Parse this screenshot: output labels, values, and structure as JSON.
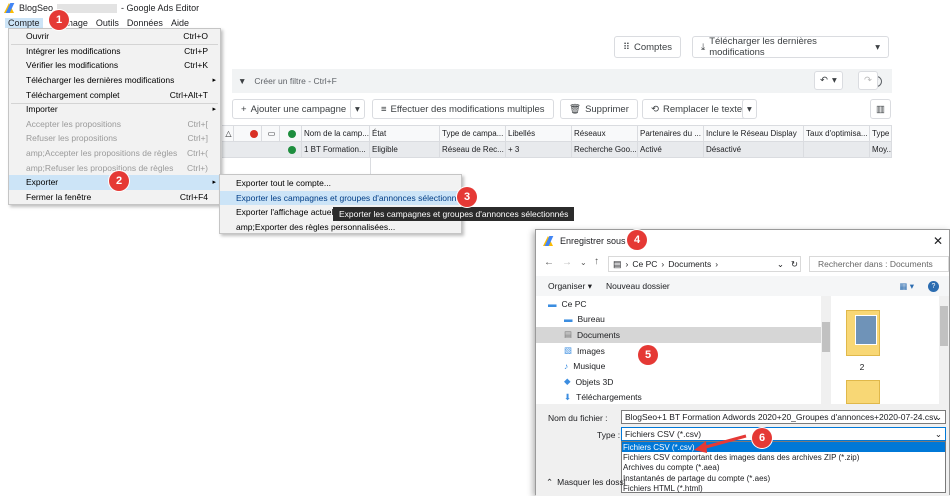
{
  "titlebar": {
    "app_name": "BlogSeo",
    "title_suffix": "- Google Ads Editor"
  },
  "menubar": {
    "items": [
      "Compte",
      "Affichage",
      "Outils",
      "Données",
      "Aide"
    ]
  },
  "toolbar": {
    "accounts_label": "Comptes",
    "download_label": "Télécharger les dernières modifications"
  },
  "filter": {
    "placeholder": "Créer un filtre - Ctrl+F"
  },
  "actions": {
    "add_campaign": "Ajouter une campagne",
    "multiple_changes": "Effectuer des modifications multiples",
    "delete": "Supprimer",
    "replace_text": "Remplacer le texte"
  },
  "grid": {
    "headers": [
      "Nom de la camp...",
      "État",
      "Type de campa...",
      "Libellés",
      "Réseaux",
      "Partenaires du ...",
      "Inclure le Réseau Display",
      "Taux d'optimisa...",
      "Type"
    ],
    "row": [
      "1 BT Formation...",
      "Eligible",
      "Réseau de Rec...",
      "+ 3",
      "Recherche Goo...",
      "Activé",
      "Désactivé",
      "",
      "Moy..."
    ]
  },
  "compte_menu": {
    "items": [
      {
        "label": "Ouvrir",
        "shortcut": "Ctrl+O"
      },
      {
        "label": "Intégrer les modifications",
        "shortcut": "Ctrl+P"
      },
      {
        "label": "Vérifier les modifications",
        "shortcut": "Ctrl+K"
      },
      {
        "label": "Télécharger les dernières modifications",
        "shortcut": ""
      },
      {
        "label": "Téléchargement complet",
        "shortcut": "Ctrl+Alt+T"
      },
      {
        "label": "Importer",
        "shortcut": ""
      },
      {
        "label": "Accepter les propositions",
        "shortcut": "Ctrl+["
      },
      {
        "label": "Refuser les propositions",
        "shortcut": "Ctrl+]"
      },
      {
        "label": "amp;Accepter les propositions de règles",
        "shortcut": "Ctrl+("
      },
      {
        "label": "amp;Refuser les propositions de règles",
        "shortcut": "Ctrl+)"
      },
      {
        "label": "Exporter",
        "shortcut": ""
      },
      {
        "label": "Fermer la fenêtre",
        "shortcut": "Ctrl+F4"
      }
    ]
  },
  "export_submenu": {
    "items": [
      "Exporter tout le compte...",
      "Exporter les campagnes et groupes d'annonces sélectionnés...",
      "Exporter l'affichage actuel...",
      "amp;Exporter des règles personnalisées..."
    ]
  },
  "tooltip": "Exporter les campagnes et groupes d'annonces sélectionnés",
  "badges": [
    "1",
    "2",
    "3",
    "4",
    "5",
    "6"
  ],
  "dialog": {
    "title": "Enregistrer sous",
    "breadcrumb": [
      "Ce PC",
      "Documents"
    ],
    "search_placeholder": "Rechercher dans : Documents",
    "organize": "Organiser",
    "new_folder": "Nouveau dossier",
    "tree": [
      "Ce PC",
      "Bureau",
      "Documents",
      "Images",
      "Musique",
      "Objets 3D",
      "Téléchargements"
    ],
    "folder_label": "2",
    "filename_label": "Nom du fichier :",
    "filename_value": "BlogSeo+1 BT Formation Adwords 2020+20_Groupes d'annonces+2020-07-24.csv",
    "type_label": "Type :",
    "type_value": "Fichiers CSV (*.csv)",
    "type_options": [
      "Fichiers CSV (*.csv)",
      "Fichiers CSV comportant des images dans des archives ZIP (*.zip)",
      "Archives du compte (*.aea)",
      "Instantanés de partage du compte (*.aes)",
      "Fichiers HTML (*.html)"
    ],
    "hide_folders": "Masquer les dossi"
  },
  "colors": {
    "badge": "#e53935",
    "highlight": "#cce4f7",
    "selected_option": "#0078d7"
  }
}
